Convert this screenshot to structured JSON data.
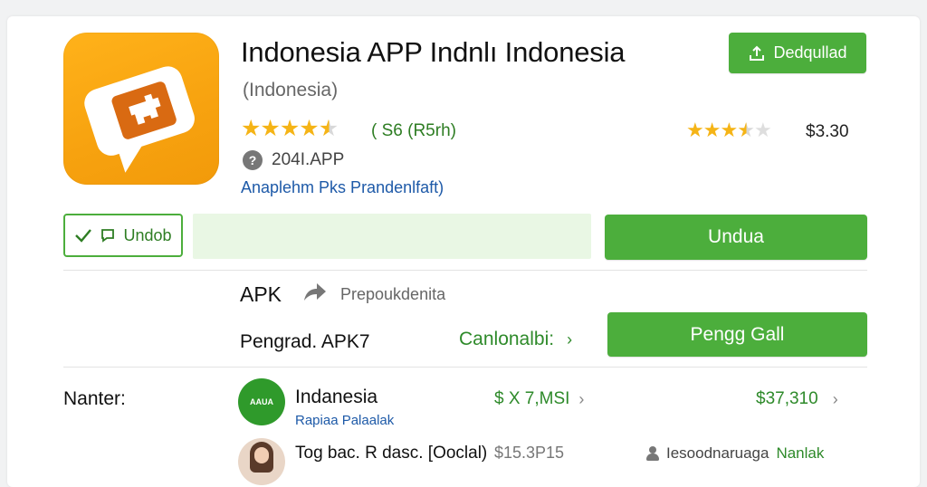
{
  "app": {
    "title": "Indonesia APP Indnlı Indonesia",
    "subtitle": "(Indonesia)",
    "rating_count": "( S6 (R5rh)",
    "price": "$3.30",
    "developer": "204I.APP",
    "category": "Anaplehm Pks Prandenlfaft)",
    "rating_left": 4.5,
    "rating_right": 3.5
  },
  "buttons": {
    "download_top": "Dedqullad",
    "undob": "Undob",
    "unduh": "Undua",
    "pengg": "Pengg Gall"
  },
  "details": {
    "apk_label": "APK",
    "share_text": "Prepoukdenita",
    "pengrad_label": "Pengrad. APK7",
    "cancel_link": "Canlonalbi:"
  },
  "list": {
    "name_label": "Nanter:",
    "rows": [
      {
        "avatar_text": "AAUA",
        "name": "Indanesia",
        "sub": "Rapiaa Palaalak",
        "value1": "$ X 7,MSI",
        "value2": "$37,310"
      },
      {
        "name": "Tog bac. R dasc. [Ooclal)",
        "price": "$15.3P15",
        "meta_text": "Iesoodnaruaga",
        "meta_link": "Nanlak"
      }
    ]
  },
  "colors": {
    "accent_green": "#4cae3c",
    "icon_orange": "#f7a20f",
    "star_gold": "#f5b416",
    "link_blue": "#1e5aa8"
  },
  "icons": [
    "upload-icon",
    "check-icon",
    "chat-icon",
    "share-arrow-icon",
    "chevron-right-icon",
    "user-icon",
    "developer-badge-icon"
  ]
}
